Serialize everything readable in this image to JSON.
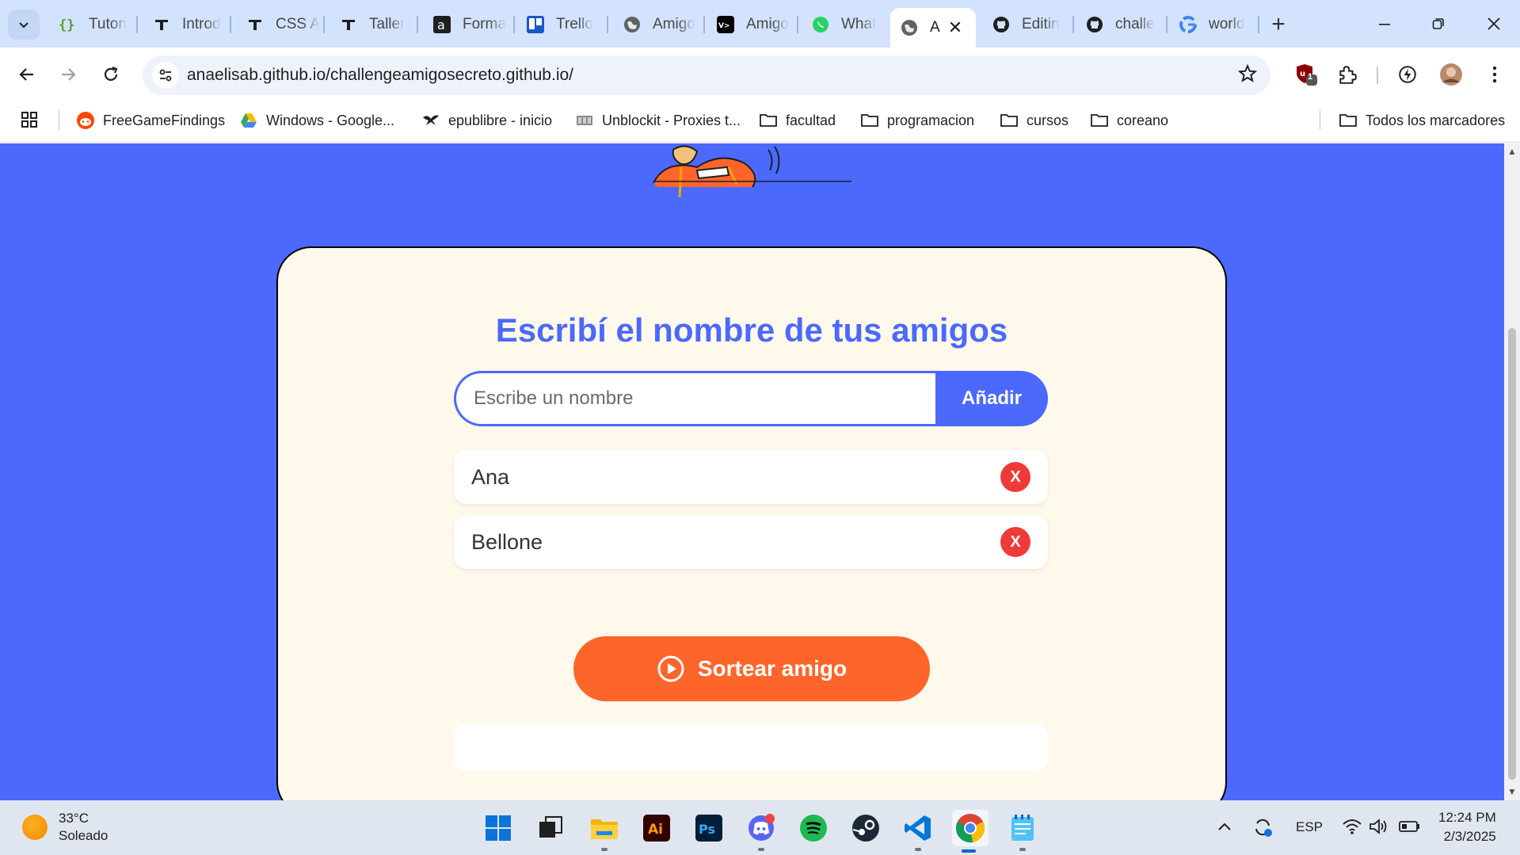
{
  "browser": {
    "tabs": [
      {
        "label": "Tutori",
        "icon": "braces-icon"
      },
      {
        "label": "Introd",
        "icon": "t-icon"
      },
      {
        "label": "CSS A",
        "icon": "t-icon"
      },
      {
        "label": "Taller",
        "icon": "t-icon"
      },
      {
        "label": "Forma",
        "icon": "a-icon"
      },
      {
        "label": "Trello",
        "icon": "trello-icon"
      },
      {
        "label": "Amigo",
        "icon": "globe-icon"
      },
      {
        "label": "Amigo",
        "icon": "vercel-icon"
      },
      {
        "label": "What",
        "icon": "whatsapp-icon"
      },
      {
        "label": "A",
        "icon": "globe-icon",
        "active": true
      },
      {
        "label": "Editin",
        "icon": "github-icon"
      },
      {
        "label": "challe",
        "icon": "github-icon"
      },
      {
        "label": "world",
        "icon": "google-icon"
      }
    ],
    "url": "anaelisab.github.io/challengeamigosecreto.github.io/",
    "extension_badge": "1",
    "bookmarks": [
      {
        "label": "FreeGameFindings",
        "icon": "reddit-icon"
      },
      {
        "label": "Windows - Google...",
        "icon": "drive-icon"
      },
      {
        "label": "epublibre - inicio",
        "icon": "bird-icon"
      },
      {
        "label": "Unblockit - Proxies t...",
        "icon": "proxy-icon"
      },
      {
        "label": "facultad",
        "icon": "folder-icon"
      },
      {
        "label": "programacion",
        "icon": "folder-icon"
      },
      {
        "label": "cursos",
        "icon": "folder-icon"
      },
      {
        "label": "coreano",
        "icon": "folder-icon"
      }
    ],
    "all_bookmarks_label": "Todos los marcadores"
  },
  "page": {
    "title": "Escribí el nombre de tus amigos",
    "input_placeholder": "Escribe un nombre",
    "input_value": "",
    "add_button": "Añadir",
    "friends": [
      "Ana",
      "Bellone"
    ],
    "remove_label": "X",
    "draw_button": "Sortear amigo",
    "result": ""
  },
  "taskbar": {
    "weather_temp": "33°C",
    "weather_desc": "Soleado",
    "language": "ESP",
    "time": "12:24 PM",
    "date": "2/3/2025"
  },
  "colors": {
    "page_background": "#4b69fd",
    "card_background": "#fff9eb",
    "title_color": "#4b69fd",
    "draw_button": "#fe652b",
    "remove_button": "#f03a3a"
  }
}
